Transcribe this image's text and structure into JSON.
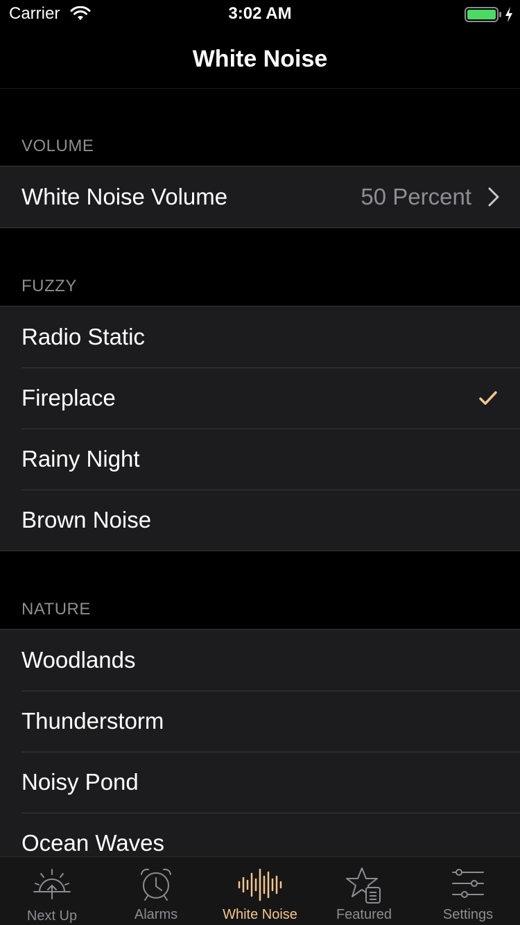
{
  "status": {
    "carrier": "Carrier",
    "time": "3:02 AM"
  },
  "nav": {
    "title": "White Noise"
  },
  "sections": {
    "volume": {
      "header": "VOLUME",
      "row_label": "White Noise Volume",
      "row_value": "50 Percent"
    },
    "fuzzy": {
      "header": "FUZZY",
      "items": [
        "Radio Static",
        "Fireplace",
        "Rainy Night",
        "Brown Noise"
      ],
      "selected": "Fireplace"
    },
    "nature": {
      "header": "NATURE",
      "items": [
        "Woodlands",
        "Thunderstorm",
        "Noisy Pond",
        "Ocean Waves"
      ]
    }
  },
  "tabs": [
    {
      "label": "Next Up",
      "icon": "sunrise-icon"
    },
    {
      "label": "Alarms",
      "icon": "alarm-clock-icon"
    },
    {
      "label": "White Noise",
      "icon": "waveform-icon",
      "active": true
    },
    {
      "label": "Featured",
      "icon": "star-document-icon"
    },
    {
      "label": "Settings",
      "icon": "sliders-icon"
    }
  ],
  "colors": {
    "background": "#000000",
    "cell": "#1c1c1e",
    "accent": "#f5c58f",
    "secondary_text": "#8d8d93"
  }
}
